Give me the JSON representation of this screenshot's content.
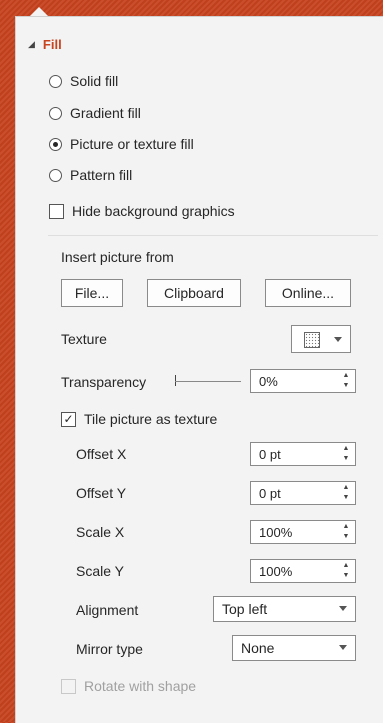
{
  "section": {
    "title": "Fill",
    "expanded": true
  },
  "fill_options": [
    {
      "label": "Solid fill",
      "selected": false
    },
    {
      "label": "Gradient fill",
      "selected": false
    },
    {
      "label": "Picture or texture fill",
      "selected": true
    },
    {
      "label": "Pattern fill",
      "selected": false
    }
  ],
  "hide_background": {
    "label": "Hide background graphics",
    "checked": false
  },
  "insert_picture": {
    "label": "Insert picture from",
    "file_button": "File...",
    "clipboard_button": "Clipboard",
    "online_button": "Online..."
  },
  "texture": {
    "label": "Texture"
  },
  "transparency": {
    "label": "Transparency",
    "value": "0%"
  },
  "tile": {
    "label": "Tile picture as texture",
    "checked": true
  },
  "offset_x": {
    "label": "Offset X",
    "value": "0 pt"
  },
  "offset_y": {
    "label": "Offset Y",
    "value": "0 pt"
  },
  "scale_x": {
    "label": "Scale X",
    "value": "100%"
  },
  "scale_y": {
    "label": "Scale Y",
    "value": "100%"
  },
  "alignment": {
    "label": "Alignment",
    "value": "Top left"
  },
  "mirror_type": {
    "label": "Mirror type",
    "value": "None"
  },
  "rotate_with_shape": {
    "label": "Rotate with shape",
    "checked": false,
    "disabled": true
  },
  "colors": {
    "accent": "#c8431f",
    "pane_bg": "#f3f3f3"
  }
}
